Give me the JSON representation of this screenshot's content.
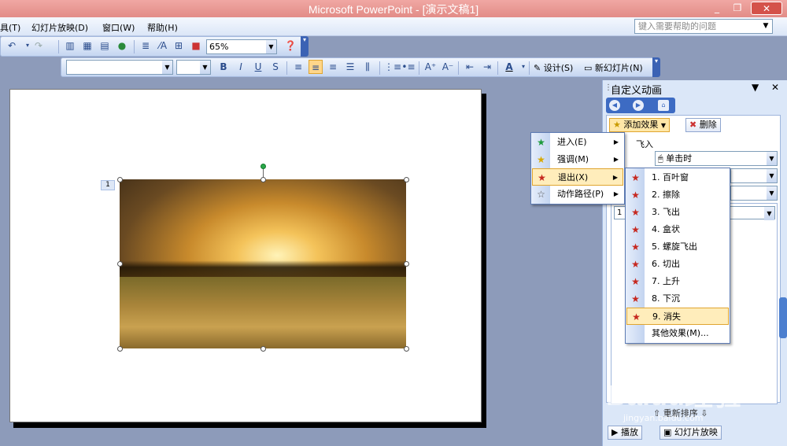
{
  "window": {
    "title": "Microsoft PowerPoint - [演示文稿1]",
    "minimize": "_",
    "restore": "❐",
    "close": "✕"
  },
  "menubar": [
    "具(T)",
    "幻灯片放映(D)",
    "窗口(W)",
    "帮助(H)"
  ],
  "help_placeholder": "键入需要帮助的问题",
  "toolbar": {
    "zoom": "65%",
    "font_name": "",
    "font_size": "",
    "bold": "B",
    "italic": "I",
    "underline": "U",
    "shadow": "S",
    "font_color": "A",
    "design_label": "设计(S)",
    "new_slide_label": "新幻灯片(N)"
  },
  "slide": {
    "anim_tag": "1"
  },
  "task_pane": {
    "title": "自定义动画",
    "add_effect": "添加效果",
    "remove": "删除",
    "fly_label": "飞入",
    "start_value": "单击时",
    "list_item": "1  635...",
    "reorder": "重新排序",
    "play": "播放",
    "slideshow": "幻灯片放映"
  },
  "effect_menu": [
    {
      "label": "进入(E)",
      "icon": "entrance-star-icon"
    },
    {
      "label": "强调(M)",
      "icon": "emphasis-star-icon"
    },
    {
      "label": "退出(X)",
      "icon": "exit-star-icon"
    },
    {
      "label": "动作路径(P)",
      "icon": "motion-path-icon"
    }
  ],
  "exit_submenu": [
    "1. 百叶窗",
    "2. 擦除",
    "3. 飞出",
    "4. 盒状",
    "5. 螺旋飞出",
    "6. 切出",
    "7. 上升",
    "8. 下沉",
    "9. 消失",
    "其他效果(M)..."
  ],
  "watermark": {
    "logo": "Baidu经验",
    "url": "jingyan.baidu.com"
  }
}
